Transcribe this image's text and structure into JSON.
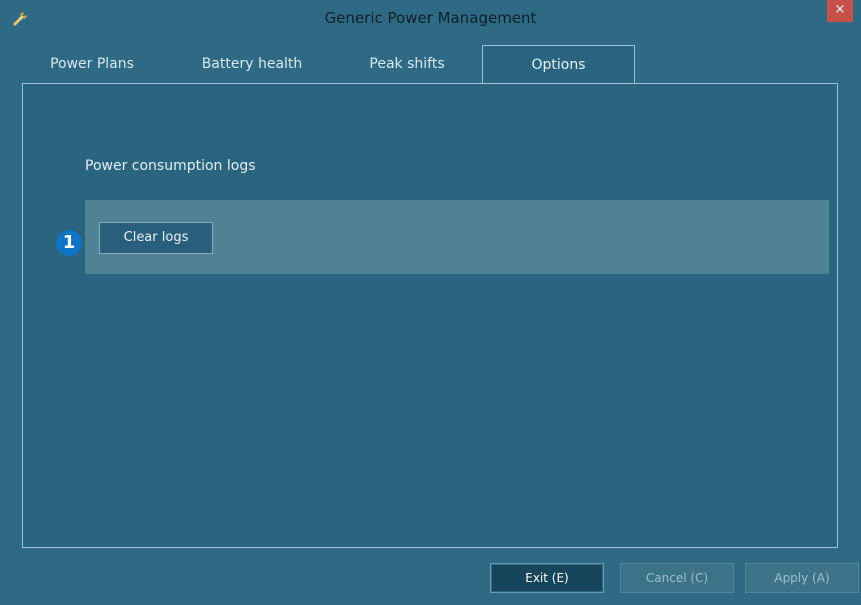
{
  "window": {
    "title": "Generic Power Management",
    "close_label": "×",
    "icon": "power-plug-icon"
  },
  "tabs": [
    {
      "label": "Power Plans",
      "active": false
    },
    {
      "label": "Battery health",
      "active": false
    },
    {
      "label": "Peak shifts",
      "active": false
    },
    {
      "label": "Options",
      "active": true
    }
  ],
  "options": {
    "section_title": "Power consumption logs",
    "callout_number": "1",
    "clear_logs_label": "Clear logs"
  },
  "footer": {
    "exit_label": "Exit (E)",
    "cancel_label": "Cancel (C)",
    "apply_label": "Apply (A)"
  },
  "colors": {
    "background": "#2f6a85",
    "panel": "#2a6580",
    "logs_box": "#4e8396",
    "close_button": "#c7504a",
    "callout": "#0f74c4"
  }
}
